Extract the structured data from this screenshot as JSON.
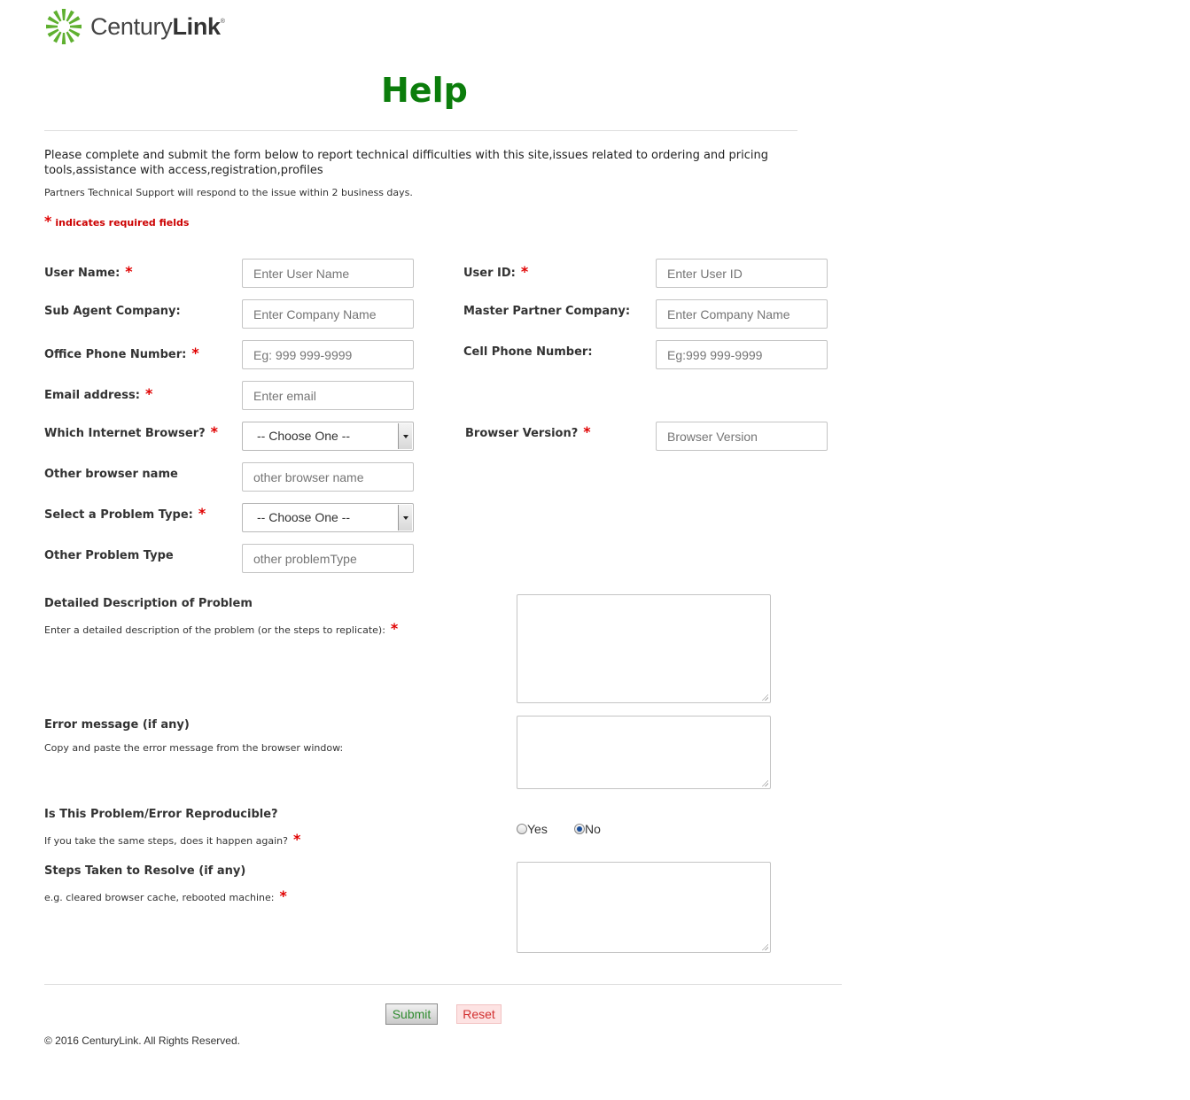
{
  "brand": {
    "name_regular": "Century",
    "name_bold": "Link",
    "registered": "®",
    "logo_color": "#5fb030"
  },
  "page": {
    "title": "Help",
    "intro": "Please complete and submit the form below to report technical difficulties with this site,issues related to ordering and pricing tools,assistance with access,registration,profiles",
    "response_note": "Partners Technical Support will respond to the issue within 2 business days.",
    "required_star": "*",
    "required_note": "indicates required fields"
  },
  "form": {
    "user_name": {
      "label": "User Name:",
      "placeholder": "Enter User Name"
    },
    "user_id": {
      "label": "User ID:",
      "placeholder": "Enter User ID"
    },
    "sub_agent": {
      "label": "Sub Agent Company:",
      "placeholder": "Enter Company Name"
    },
    "master_partner": {
      "label": "Master Partner Company:",
      "placeholder": "Enter Company Name"
    },
    "office_phone": {
      "label": "Office Phone Number:",
      "placeholder": "Eg: 999 999-9999"
    },
    "cell_phone": {
      "label": "Cell Phone Number:",
      "placeholder": "Eg:999 999-9999"
    },
    "email": {
      "label": "Email address:",
      "placeholder": "Enter email"
    },
    "browser": {
      "label": "Which Internet Browser?",
      "selected": "-- Choose One --"
    },
    "browser_version": {
      "label": "Browser Version?",
      "placeholder": "Browser Version"
    },
    "other_browser": {
      "label": "Other browser name",
      "placeholder": "other browser name"
    },
    "problem_type": {
      "label": "Select a Problem Type:",
      "selected": "-- Choose One --"
    },
    "other_problem": {
      "label": "Other Problem Type",
      "placeholder": "other problemType"
    },
    "description": {
      "label": "Detailed Description of Problem",
      "hint": "Enter a detailed description of the problem (or the steps to replicate):"
    },
    "error_message": {
      "label": "Error message (if any)",
      "hint": "Copy and paste the error message from the browser window:"
    },
    "reproducible": {
      "label": "Is This Problem/Error Reproducible?",
      "hint": "If you take the same steps, does it happen again?",
      "options": [
        "Yes",
        "No"
      ],
      "selected": "No"
    },
    "steps": {
      "label": "Steps Taken to Resolve (if any)",
      "hint": "e.g. cleared browser cache, rebooted machine:"
    }
  },
  "actions": {
    "submit": "Submit",
    "reset": "Reset"
  },
  "footer": {
    "copyright": "© 2016 CenturyLink. All Rights Reserved."
  }
}
